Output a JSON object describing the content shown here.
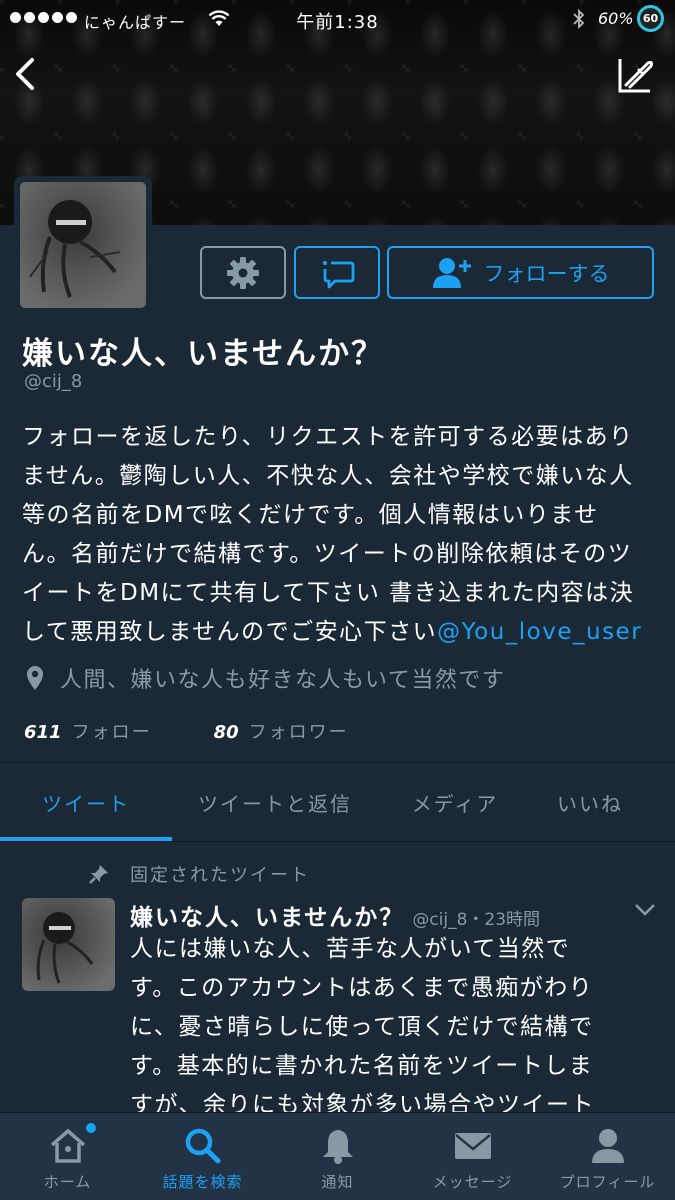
{
  "status_bar": {
    "carrier": "にゃんぱすー",
    "time": "午前1:38",
    "battery_percent": "60%",
    "battery_badge": "60"
  },
  "profile": {
    "display_name": "嫌いな人、いませんか？",
    "handle": "@cij_8",
    "follow_button_label": "フォローする",
    "bio_lines": [
      "フォローを返したり、リクエストを許可する必要はあり",
      "ません。鬱陶しい人、不快な人、会社や学校で嫌いな人",
      "等の名前をDMで呟くだけです。個人情報はいりませ",
      "ん。名前だけで結構です。ツイートの削除依頼はそのツ",
      "イートをDMにて共有して下さい 書き込まれた内容は決"
    ],
    "bio_last_line_text": "して悪用致しませんのでご安心下さい",
    "bio_mention": "@You_love_user",
    "location": "人間、嫌いな人も好きな人もいて当然です",
    "following_count": "611",
    "following_label": "フォロー",
    "followers_count": "80",
    "followers_label": "フォロワー"
  },
  "tabs": [
    {
      "label": "ツイート",
      "active": true
    },
    {
      "label": "ツイートと返信",
      "active": false
    },
    {
      "label": "メディア",
      "active": false
    },
    {
      "label": "いいね",
      "active": false
    }
  ],
  "pinned_tweet": {
    "pinned_label": "固定されたツイート",
    "author_name": "嫌いな人、いませんか？",
    "meta": "@cij_8・23時間",
    "text_lines": [
      "人には嫌いな人、苦手な人がいて当然で",
      "す。このアカウントはあくまで愚痴がわり",
      "に、憂さ晴らしに使って頂くだけで結構で",
      "す。基本的に書かれた名前をツイートしま",
      "すが、余りにも対象が多い場合やツイート"
    ]
  },
  "tabbar": [
    {
      "label": "ホーム",
      "icon": "home-icon"
    },
    {
      "label": "話題を検索",
      "icon": "search-icon"
    },
    {
      "label": "通知",
      "icon": "bell-icon"
    },
    {
      "label": "メッセージ",
      "icon": "envelope-icon"
    },
    {
      "label": "プロフィール",
      "icon": "person-icon"
    }
  ],
  "colors": {
    "background": "#1b2836",
    "accent": "#1da1f2",
    "muted": "#8899a6"
  }
}
